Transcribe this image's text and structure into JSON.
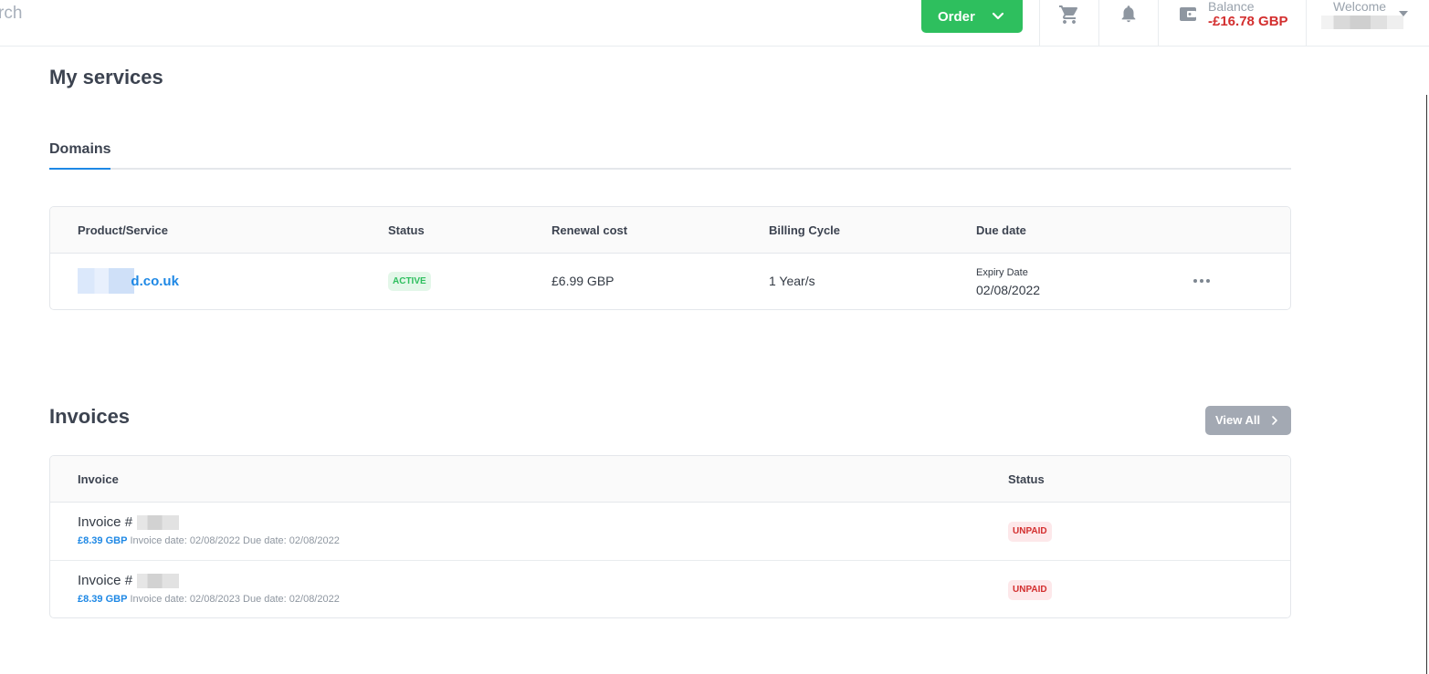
{
  "topbar": {
    "search_text": "rch",
    "order_label": "Order",
    "balance_label": "Balance",
    "balance_amount": "-£16.78 GBP",
    "welcome_label": "Welcome"
  },
  "services": {
    "title": "My services",
    "tab_label": "Domains",
    "columns": {
      "product": "Product/Service",
      "status": "Status",
      "renewal": "Renewal cost",
      "billing": "Billing Cycle",
      "due": "Due date"
    },
    "rows": [
      {
        "domain_visible": "d.co.uk",
        "status": "ACTIVE",
        "renewal": "£6.99 GBP",
        "billing": "1 Year/s",
        "due_label": "Expiry Date",
        "due_date": "02/08/2022"
      }
    ]
  },
  "invoices": {
    "title": "Invoices",
    "view_all_label": "View All",
    "columns": {
      "invoice": "Invoice",
      "status": "Status"
    },
    "rows": [
      {
        "title": "Invoice #",
        "amount": "£8.39 GBP",
        "dates": "Invoice date: 02/08/2022 Due date: 02/08/2022",
        "status": "UNPAID"
      },
      {
        "title": "Invoice #",
        "amount": "£8.39 GBP",
        "dates": "Invoice date: 02/08/2023 Due date: 02/08/2022",
        "status": "UNPAID"
      }
    ]
  },
  "colors": {
    "accent": "#1e88e5",
    "order_green": "#2ebf5e",
    "balance_red": "#d32f2f",
    "active_bg": "#e3f7e9",
    "unpaid_bg": "#fde8ea"
  }
}
